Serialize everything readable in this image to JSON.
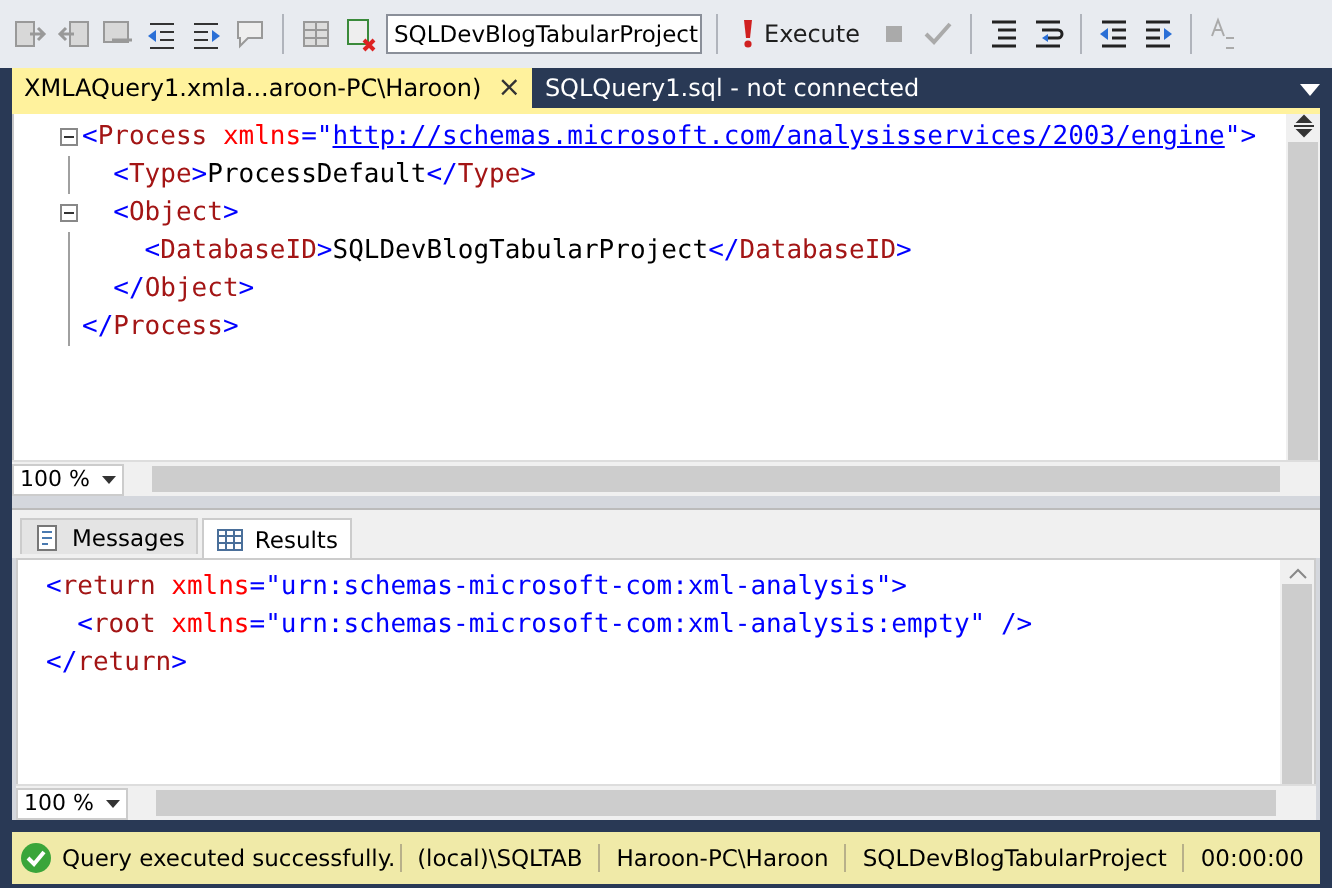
{
  "toolbar": {
    "database": "SQLDevBlogTabularProject",
    "execute": "Execute"
  },
  "tabs": [
    {
      "label": "XMLAQuery1.xmla...aroon-PC\\Haroon)",
      "selected": true,
      "close": "×"
    },
    {
      "label": "SQLQuery1.sql - not connected",
      "selected": false
    }
  ],
  "editor": {
    "lines": [
      {
        "fold": true,
        "tokens": [
          {
            "kind": "punct",
            "text": "<"
          },
          {
            "kind": "tag",
            "text": "Process"
          },
          {
            "kind": "attr",
            "text": " xmlns"
          },
          {
            "kind": "punct",
            "text": "=\""
          },
          {
            "kind": "link",
            "text": "http://schemas.microsoft.com/analysisservices/2003/engine"
          },
          {
            "kind": "punct",
            "text": "\">"
          }
        ]
      },
      {
        "fold": false,
        "tokens": [
          {
            "kind": "punct",
            "text": "  <"
          },
          {
            "kind": "tag",
            "text": "Type"
          },
          {
            "kind": "punct",
            "text": ">"
          },
          {
            "kind": "text",
            "text": "ProcessDefault"
          },
          {
            "kind": "punct",
            "text": "</"
          },
          {
            "kind": "tag",
            "text": "Type"
          },
          {
            "kind": "punct",
            "text": ">"
          }
        ]
      },
      {
        "fold": true,
        "tokens": [
          {
            "kind": "punct",
            "text": "  <"
          },
          {
            "kind": "tag",
            "text": "Object"
          },
          {
            "kind": "punct",
            "text": ">"
          }
        ]
      },
      {
        "fold": false,
        "tokens": [
          {
            "kind": "punct",
            "text": "    <"
          },
          {
            "kind": "tag",
            "text": "DatabaseID"
          },
          {
            "kind": "punct",
            "text": ">"
          },
          {
            "kind": "text",
            "text": "SQLDevBlogTabularProject"
          },
          {
            "kind": "punct",
            "text": "</"
          },
          {
            "kind": "tag",
            "text": "DatabaseID"
          },
          {
            "kind": "punct",
            "text": ">"
          }
        ]
      },
      {
        "fold": false,
        "tokens": [
          {
            "kind": "punct",
            "text": "  </"
          },
          {
            "kind": "tag",
            "text": "Object"
          },
          {
            "kind": "punct",
            "text": ">"
          }
        ]
      },
      {
        "fold": false,
        "tokens": [
          {
            "kind": "punct",
            "text": "</"
          },
          {
            "kind": "tag",
            "text": "Process"
          },
          {
            "kind": "punct",
            "text": ">"
          }
        ]
      }
    ],
    "zoom": "100 %"
  },
  "result_tabs": [
    {
      "label": "Messages",
      "selected": false,
      "kind": "messages"
    },
    {
      "label": "Results",
      "selected": true,
      "kind": "grid"
    }
  ],
  "results": {
    "lines": [
      {
        "tokens": [
          {
            "kind": "punct",
            "text": "<"
          },
          {
            "kind": "tag",
            "text": "return"
          },
          {
            "kind": "attr",
            "text": " xmlns"
          },
          {
            "kind": "punct",
            "text": "=\"urn:schemas-microsoft-com:xml-analysis\">"
          }
        ]
      },
      {
        "tokens": [
          {
            "kind": "punct",
            "text": "  <"
          },
          {
            "kind": "tag",
            "text": "root"
          },
          {
            "kind": "attr",
            "text": " xmlns"
          },
          {
            "kind": "punct",
            "text": "=\"urn:schemas-microsoft-com:xml-analysis:empty\" />"
          }
        ]
      },
      {
        "tokens": [
          {
            "kind": "punct",
            "text": "</"
          },
          {
            "kind": "tag",
            "text": "return"
          },
          {
            "kind": "punct",
            "text": ">"
          }
        ]
      }
    ],
    "zoom": "100 %"
  },
  "status_bar": {
    "message": "Query executed successfully.",
    "server": "(local)\\SQLTAB",
    "user": "Haroon-PC\\Haroon",
    "database": "SQLDevBlogTabularProject",
    "time": "00:00:00"
  }
}
